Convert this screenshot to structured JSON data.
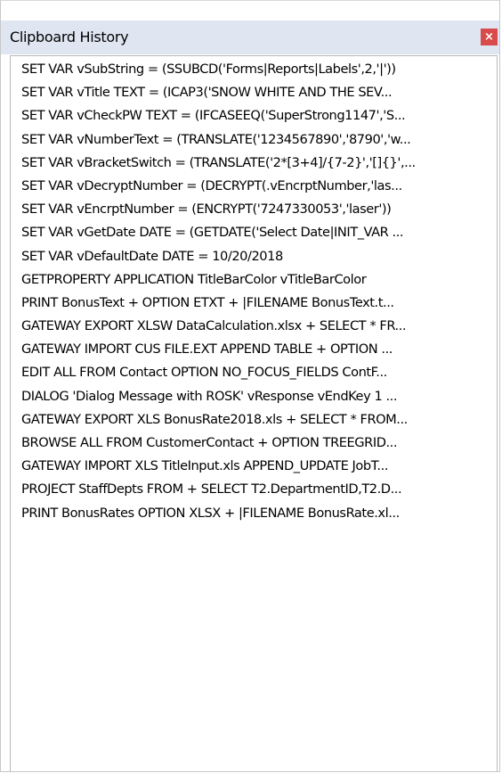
{
  "window": {
    "title": "Clipboard History",
    "close_label": "×"
  },
  "history": {
    "items": [
      "SET VAR vSubString = (SSUBCD('Forms|Reports|Labels',2,'|'))",
      "SET VAR vTitle TEXT = (ICAP3('SNOW WHITE AND THE SEV...",
      "SET VAR vCheckPW TEXT = (IFCASEEQ('SuperStrong1147','S...",
      "SET VAR vNumberText = (TRANSLATE('1234567890','8790','w...",
      "SET VAR vBracketSwitch = (TRANSLATE('2*[3+4]/{7-2}','[]{}',...",
      "SET VAR vDecryptNumber = (DECRYPT(.vEncrptNumber,'las...",
      "SET VAR vEncrptNumber = (ENCRYPT('7247330053','laser'))",
      "SET VAR vGetDate DATE = (GETDATE('Select Date|INIT_VAR ...",
      "SET VAR vDefaultDate DATE = 10/20/2018",
      "GETPROPERTY APPLICATION TitleBarColor vTitleBarColor",
      "PRINT BonusText + OPTION ETXT + |FILENAME BonusText.t...",
      "GATEWAY EXPORT XLSW DataCalculation.xlsx + SELECT * FR...",
      "GATEWAY IMPORT CUS FILE.EXT APPEND TABLE + OPTION ...",
      "EDIT ALL FROM Contact OPTION NO_FOCUS_FIELDS ContF...",
      "DIALOG 'Dialog Message with ROSK' vResponse vEndKey 1 ...",
      "GATEWAY EXPORT XLS BonusRate2018.xls + SELECT * FROM...",
      "BROWSE ALL FROM CustomerContact + OPTION TREEGRID...",
      "GATEWAY IMPORT XLS TitleInput.xls APPEND_UPDATE JobT...",
      "PROJECT StaffDepts FROM + SELECT T2.DepartmentID,T2.D...",
      "PRINT BonusRates OPTION XLSX + |FILENAME BonusRate.xl..."
    ]
  },
  "colors": {
    "titlebar_bg": "#dfe6f2",
    "close_button_bg": "#d94a4a"
  }
}
